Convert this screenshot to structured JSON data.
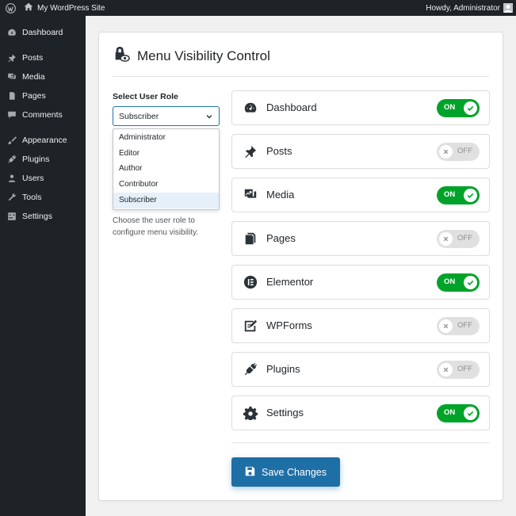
{
  "admin_bar": {
    "site_name": "My WordPress Site",
    "greeting": "Howdy, Administrator",
    "wp_logo_icon": "wordpress-logo-icon",
    "home_icon": "home-icon",
    "avatar_icon": "user-avatar-icon"
  },
  "sidebar": {
    "items": [
      {
        "label": "Dashboard",
        "icon": "dashboard-icon"
      },
      {
        "label": "Posts",
        "icon": "pin-icon"
      },
      {
        "label": "Media",
        "icon": "media-icon"
      },
      {
        "label": "Pages",
        "icon": "pages-icon"
      },
      {
        "label": "Comments",
        "icon": "comments-icon"
      },
      {
        "label": "Appearance",
        "icon": "brush-icon"
      },
      {
        "label": "Plugins",
        "icon": "plug-icon"
      },
      {
        "label": "Users",
        "icon": "users-icon"
      },
      {
        "label": "Tools",
        "icon": "wrench-icon"
      },
      {
        "label": "Settings",
        "icon": "settings-icon"
      }
    ]
  },
  "panel": {
    "title": "Menu Visibility Control",
    "title_icon": "lock-eye-icon",
    "role_label": "Select User Role",
    "selected_role": "Subscriber",
    "role_options": [
      "Administrator",
      "Editor",
      "Author",
      "Contributor",
      "Subscriber"
    ],
    "help_text": "Choose the user role to configure menu visibility.",
    "toggles": [
      {
        "label": "Dashboard",
        "icon": "speedometer-icon",
        "state": "ON"
      },
      {
        "label": "Posts",
        "icon": "pin-icon",
        "state": "OFF"
      },
      {
        "label": "Media",
        "icon": "media-icon",
        "state": "ON"
      },
      {
        "label": "Pages",
        "icon": "pages-icon",
        "state": "OFF"
      },
      {
        "label": "Elementor",
        "icon": "elementor-icon",
        "state": "ON"
      },
      {
        "label": "WPForms",
        "icon": "form-edit-icon",
        "state": "OFF"
      },
      {
        "label": "Plugins",
        "icon": "plug-icon",
        "state": "OFF"
      },
      {
        "label": "Settings",
        "icon": "gear-icon",
        "state": "ON"
      }
    ],
    "save_label": "Save Changes",
    "save_icon": "floppy-disk-icon"
  },
  "colors": {
    "admin_dark": "#1d2327",
    "toggle_on": "#00a32a",
    "toggle_off": "#e0e0e0",
    "primary": "#1e6fa6",
    "selected_option": "#e5f0fa"
  }
}
